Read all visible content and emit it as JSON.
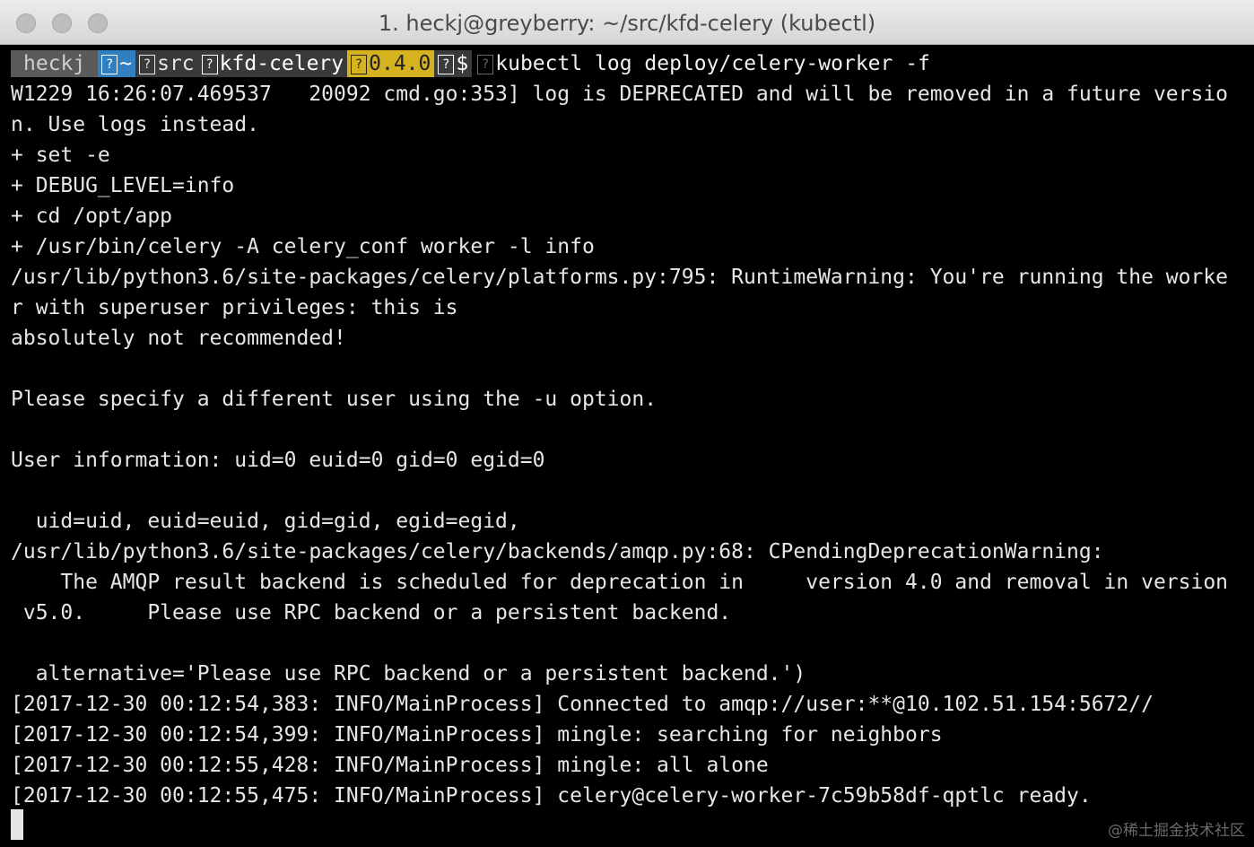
{
  "window": {
    "title": "1. heckj@greyberry: ~/src/kfd-celery (kubectl)"
  },
  "prompt": {
    "user": "heckj",
    "home": "~",
    "dir1": "src",
    "dir2": "kfd-celery",
    "version": "0.4.0",
    "dollar": "$",
    "command": "kubectl log deploy/celery-worker -f",
    "glyph": "?"
  },
  "output": [
    "W1229 16:26:07.469537   20092 cmd.go:353] log is DEPRECATED and will be removed in a future versio",
    "n. Use logs instead.",
    "+ set -e",
    "+ DEBUG_LEVEL=info",
    "+ cd /opt/app",
    "+ /usr/bin/celery -A celery_conf worker -l info",
    "/usr/lib/python3.6/site-packages/celery/platforms.py:795: RuntimeWarning: You're running the worke",
    "r with superuser privileges: this is",
    "absolutely not recommended!",
    "",
    "Please specify a different user using the -u option.",
    "",
    "User information: uid=0 euid=0 gid=0 egid=0",
    "",
    "  uid=uid, euid=euid, gid=gid, egid=egid,",
    "/usr/lib/python3.6/site-packages/celery/backends/amqp.py:68: CPendingDeprecationWarning:",
    "    The AMQP result backend is scheduled for deprecation in     version 4.0 and removal in version",
    " v5.0.     Please use RPC backend or a persistent backend.",
    "",
    "  alternative='Please use RPC backend or a persistent backend.')",
    "[2017-12-30 00:12:54,383: INFO/MainProcess] Connected to amqp://user:**@10.102.51.154:5672//",
    "[2017-12-30 00:12:54,399: INFO/MainProcess] mingle: searching for neighbors",
    "[2017-12-30 00:12:55,428: INFO/MainProcess] mingle: all alone",
    "[2017-12-30 00:12:55,475: INFO/MainProcess] celery@celery-worker-7c59b58df-qptlc ready."
  ],
  "watermark": "@稀土掘金技术社区"
}
